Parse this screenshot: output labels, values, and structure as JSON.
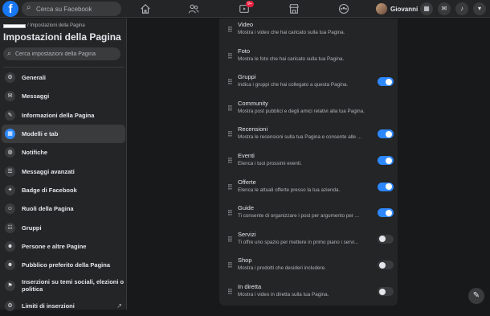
{
  "header": {
    "search_placeholder": "Cerca su Facebook",
    "logo": "f",
    "nav_icons": [
      "home-icon",
      "friends-icon",
      "watch-icon",
      "marketplace-icon",
      "groups-icon"
    ],
    "watch_badge": "9+",
    "user_name": "Giovanni",
    "right_icons": [
      "menu-grid-icon",
      "messenger-icon",
      "bell-icon",
      "dropdown-icon"
    ]
  },
  "sidebar": {
    "breadcrumb": "/ Impostazioni della Pagina",
    "title": "Impostazioni della Pagina",
    "search_placeholder": "Cerca impostazioni della Pagina",
    "items": [
      {
        "label": "Generali",
        "icon": "gear-icon",
        "glyph": "⚙"
      },
      {
        "label": "Messaggi",
        "icon": "chat-icon",
        "glyph": "✉"
      },
      {
        "label": "Informazioni della Pagina",
        "icon": "edit-icon",
        "glyph": "✎"
      },
      {
        "label": "Modelli e tab",
        "icon": "grid-icon",
        "glyph": "▦"
      },
      {
        "label": "Notifiche",
        "icon": "globe-icon",
        "glyph": "◍"
      },
      {
        "label": "Messaggi avanzati",
        "icon": "messenger-icon",
        "glyph": "☰"
      },
      {
        "label": "Badge di Facebook",
        "icon": "badge-icon",
        "glyph": "✦"
      },
      {
        "label": "Ruoli della Pagina",
        "icon": "person-icon",
        "glyph": "☺"
      },
      {
        "label": "Gruppi",
        "icon": "groups-icon",
        "glyph": "☷"
      },
      {
        "label": "Persone e altre Pagine",
        "icon": "people-icon",
        "glyph": "☻"
      },
      {
        "label": "Pubblico preferito della Pagina",
        "icon": "audience-icon",
        "glyph": "☻"
      },
      {
        "label": "Inserzioni su temi sociali, elezioni o politica",
        "icon": "flag-icon",
        "glyph": "⚑"
      },
      {
        "label": "Limiti di inserzioni",
        "icon": "gear-icon",
        "glyph": "⚙"
      }
    ],
    "active_index": 3,
    "external_link_icon": "external-link-icon"
  },
  "tabs": [
    {
      "title": "Video",
      "desc": "Mostra i video che hai caricato sulla tua Pagina.",
      "toggle": null
    },
    {
      "title": "Foto",
      "desc": "Mostra le foto che hai caricato sulla tua Pagina.",
      "toggle": null
    },
    {
      "title": "Gruppi",
      "desc": "Indica i gruppi che hai collegato a questa Pagina.",
      "toggle": true
    },
    {
      "title": "Community",
      "desc": "Mostra post pubblici e degli amici relativi alla tua Pagina.",
      "toggle": null
    },
    {
      "title": "Recensioni",
      "desc": "Mostra le recensioni sulla tua Pagina e consente alle ...",
      "toggle": true
    },
    {
      "title": "Eventi",
      "desc": "Elenca i tuoi prossimi eventi.",
      "toggle": true
    },
    {
      "title": "Offerte",
      "desc": "Elenca le attuali offerte presso la tua azienda.",
      "toggle": true
    },
    {
      "title": "Guide",
      "desc": "Ti consente di organizzare i post per argomento per ...",
      "toggle": true
    },
    {
      "title": "Servizi",
      "desc": "Ti offre uno spazio per mettere in primo piano i servi...",
      "toggle": false
    },
    {
      "title": "Shop",
      "desc": "Mostra i prodotti che desideri includere.",
      "toggle": false
    },
    {
      "title": "In diretta",
      "desc": "Mostra i video in diretta sulla tua Pagina.",
      "toggle": false
    }
  ],
  "colors": {
    "accent": "#2d88ff",
    "background": "#18191a",
    "surface": "#242526"
  }
}
